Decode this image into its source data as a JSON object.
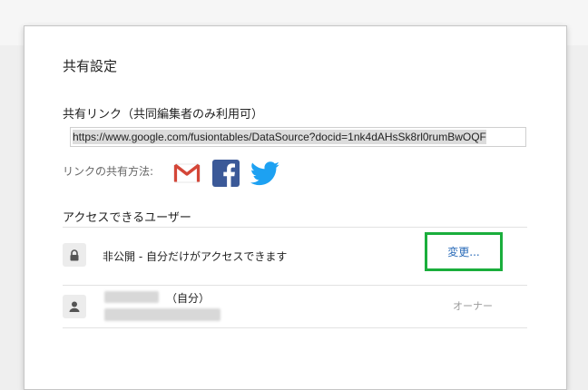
{
  "dialog": {
    "title": "共有設定",
    "link_section": {
      "label": "共有リンク（共同編集者のみ利用可）",
      "url": "https://www.google.com/fusiontables/DataSource?docid=1nk4dAHsSk8rl0rumBwOQF"
    },
    "share_via": {
      "label": "リンクの共有方法:",
      "services": [
        "gmail-icon",
        "facebook-icon",
        "twitter-icon"
      ]
    },
    "access": {
      "heading": "アクセスできるユーザー",
      "visibility": {
        "icon": "lock-icon",
        "text": "非公開 - 自分だけがアクセスできます",
        "change_label": "変更..."
      },
      "owner": {
        "icon": "person-icon",
        "self_tag": "（自分）",
        "role": "オーナー"
      }
    }
  },
  "colors": {
    "highlight_border": "#1aae3c",
    "link_blue": "#2a6bb8",
    "gmail_red": "#d44638",
    "facebook_blue": "#3b5998",
    "twitter_blue": "#1da1f2"
  }
}
